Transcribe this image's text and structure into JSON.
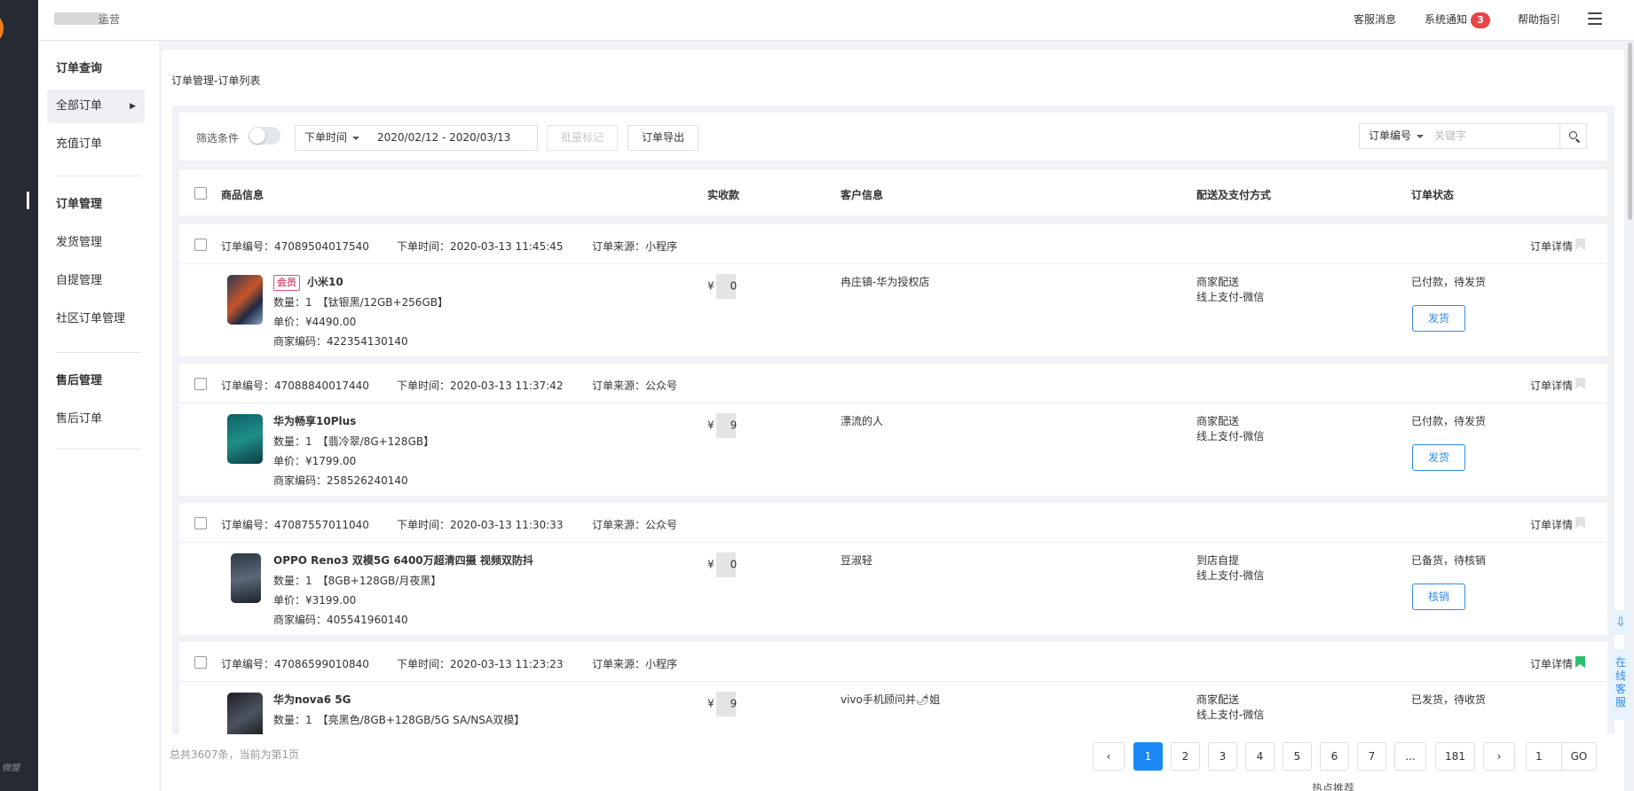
{
  "topbar": {
    "brand": "运营",
    "links": {
      "customer_msg": "客服消息",
      "system_notice": "系统通知",
      "help": "帮助指引"
    },
    "notice_count": "3"
  },
  "rail": {
    "watermark": "微盟"
  },
  "subnav": {
    "items": [
      "订单查询",
      "全部订单",
      "充值订单",
      "订单管理",
      "发货管理",
      "自提管理",
      "社区订单管理",
      "售后管理",
      "售后订单"
    ]
  },
  "page": {
    "breadcrumb": "订单管理-订单列表"
  },
  "filter": {
    "label": "筛选条件",
    "time_select": "下单时间",
    "date_range": "2020/02/12 - 2020/03/13",
    "batch_mark": "批量标记",
    "export": "订单导出",
    "search_field": "订单编号",
    "search_placeholder": "关键字"
  },
  "columns": [
    "商品信息",
    "实收款",
    "客户信息",
    "配送及支付方式",
    "订单状态"
  ],
  "orders": [
    {
      "order_no": "订单编号：47089504017540",
      "time": "下单时间：2020-03-13 11:45:45",
      "source": "订单来源：小程序",
      "detail": "订单详情",
      "tag": "会员",
      "name": "小米10",
      "qty": "数量：1　【钛银黑/12GB+256GB】",
      "price": "单价：¥4490.00",
      "code": "商家编码：422354130140",
      "paid_a": "¥",
      "paid_b": "0",
      "customer": "冉庄镇-华为授权店",
      "delivery": "商家配送",
      "pay": "线上支付-微信",
      "status": "已付款，待发货",
      "action": "发货"
    },
    {
      "order_no": "订单编号：47088840017440",
      "time": "下单时间：2020-03-13 11:37:42",
      "source": "订单来源：公众号",
      "detail": "订单详情",
      "name": "华为畅享10Plus",
      "qty": "数量：1　【翡冷翠/8G+128GB】",
      "price": "单价：¥1799.00",
      "code": "商家编码：258526240140",
      "paid_a": "¥",
      "paid_b": "9",
      "customer": "漂流的人",
      "delivery": "商家配送",
      "pay": "线上支付-微信",
      "status": "已付款，待发货",
      "action": "发货"
    },
    {
      "order_no": "订单编号：47087557011040",
      "time": "下单时间：2020-03-13 11:30:33",
      "source": "订单来源：公众号",
      "detail": "订单详情",
      "name": "OPPO Reno3 双模5G 6400万超清四摄 视频双防抖",
      "qty": "数量：1　【8GB+128GB/月夜黑】",
      "price": "单价：¥3199.00",
      "code": "商家编码：405541960140",
      "paid_a": "¥",
      "paid_b": "0",
      "customer": "豆淑轻",
      "delivery": "到店自提",
      "pay": "线上支付-微信",
      "status": "已备货，待核销",
      "action": "核销"
    },
    {
      "order_no": "订单编号：47086599010840",
      "time": "下单时间：2020-03-13 11:23:23",
      "source": "订单来源：小程序",
      "detail": "订单详情",
      "name": "华为nova6 5G",
      "qty": "数量：1　【亮黑色/8GB+128GB/5G SA/NSA双模】",
      "paid_a": "¥",
      "paid_b": "9",
      "customer": "vivo手机顾问并🌶姐",
      "delivery": "商家配送",
      "pay": "线上支付-微信",
      "status": "已发货，待收货"
    }
  ],
  "pagination": {
    "total": "总共3607条，当前为第1页",
    "pages": [
      "1",
      "2",
      "3",
      "4",
      "5",
      "6",
      "7",
      "...",
      "181"
    ],
    "prev": "‹",
    "next": "›",
    "jump_value": "1",
    "go": "GO"
  },
  "float": {
    "download_icon": "⇩",
    "service": "在线客服"
  },
  "status_bar": "热点推荐"
}
